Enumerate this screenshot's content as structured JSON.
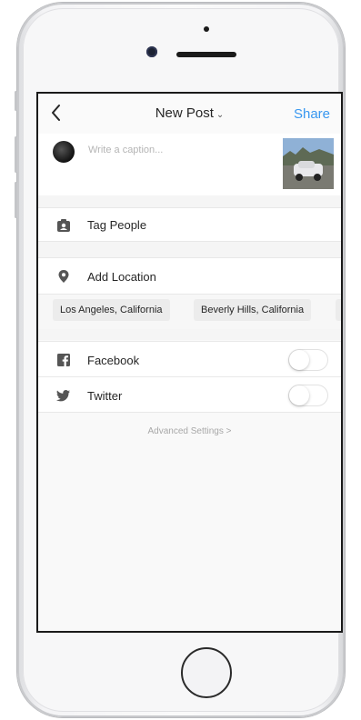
{
  "nav": {
    "back_icon": "chevron-left-icon",
    "title": "New Post",
    "share_label": "Share",
    "share_color": "#3897f0"
  },
  "caption": {
    "placeholder": "Write a caption..."
  },
  "tag_people": {
    "label": "Tag People",
    "icon": "tag-person-icon"
  },
  "add_location": {
    "label": "Add Location",
    "icon": "location-pin-icon"
  },
  "location_suggestions": [
    "Los Angeles, California",
    "Beverly Hills, California"
  ],
  "share_to": [
    {
      "label": "Facebook",
      "icon": "facebook-icon",
      "enabled": false
    },
    {
      "label": "Twitter",
      "icon": "twitter-icon",
      "enabled": false
    }
  ],
  "advanced_settings": {
    "label": "Advanced Settings >"
  }
}
